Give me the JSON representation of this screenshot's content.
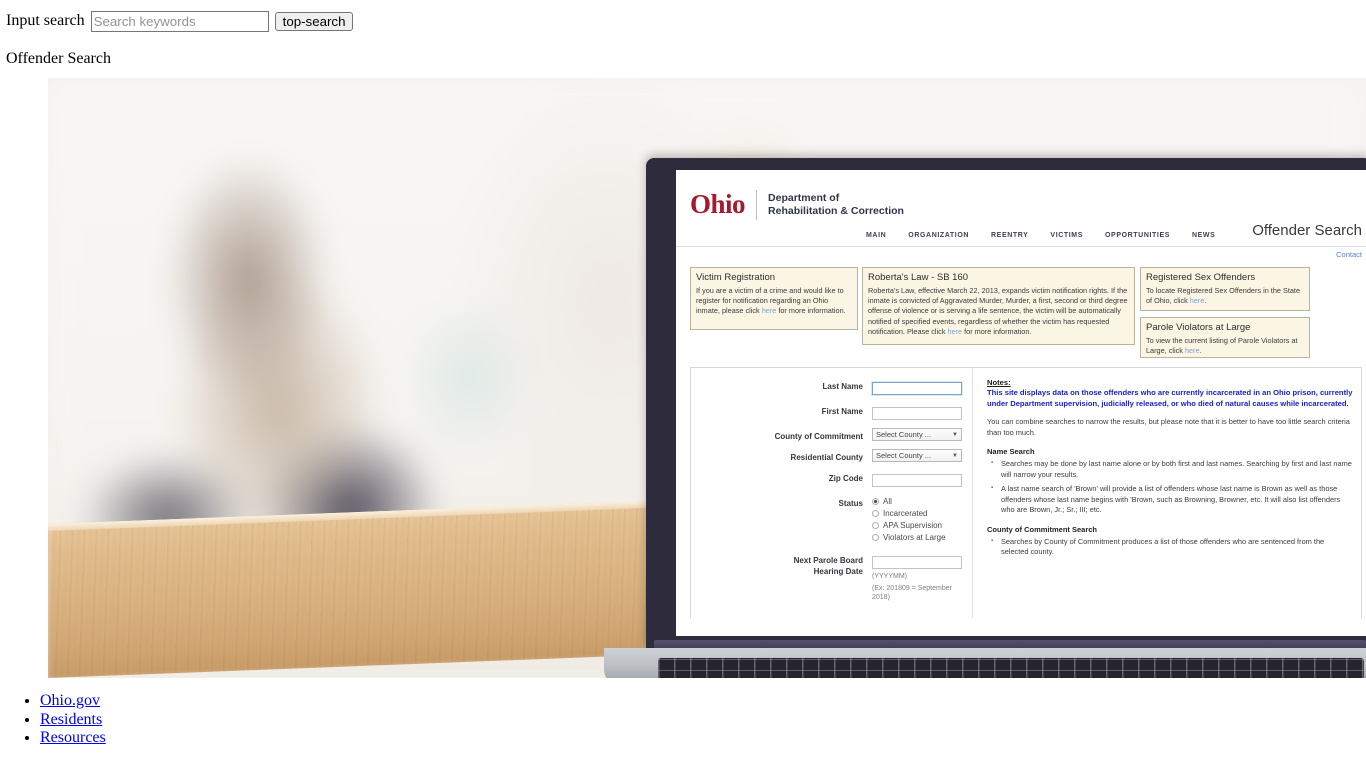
{
  "top_bar": {
    "label": "Input search",
    "placeholder": "Search keywords",
    "value": "",
    "button_label": "top-search"
  },
  "page_heading": "Offender Search",
  "site": {
    "brand": {
      "logo_word": "Ohio",
      "dept_line1": "Department of",
      "dept_line2": "Rehabilitation & Correction"
    },
    "title": "Offender Search",
    "nav": [
      {
        "label": "MAIN"
      },
      {
        "label": "ORGANIZATION"
      },
      {
        "label": "REENTRY"
      },
      {
        "label": "VICTIMS"
      },
      {
        "label": "OPPORTUNITIES"
      },
      {
        "label": "NEWS"
      }
    ],
    "contact_label": "Contact",
    "info_boxes": [
      {
        "title": "Victim Registration",
        "body_pre": "If you are a victim of a crime and would like to register for notification regarding an Ohio inmate, please click ",
        "link": "here",
        "body_post": " for more information."
      },
      {
        "title": "Roberta's Law - SB 160",
        "body_pre": "Roberta's Law, effective March 22, 2013, expands victim notification rights. If the inmate is convicted of Aggravated Murder, Murder, a first, second or third degree offense of violence or is serving a life sentence, the victim will be automatically notified of specified events, regardless of whether the victim has requested notification. Please click ",
        "link": "here",
        "body_post": " for more information."
      },
      {
        "title": "Registered Sex Offenders",
        "body_pre": "To locate Registered Sex Offenders in the State of Ohio, click ",
        "link": "here",
        "body_post": "."
      },
      {
        "title": "Parole Violators at Large",
        "body_pre": "To view the current listing of Parole Violators at Large, click ",
        "link": "here",
        "body_post": "."
      }
    ],
    "form": {
      "last_name": {
        "label": "Last Name",
        "value": ""
      },
      "first_name": {
        "label": "First Name",
        "value": ""
      },
      "county_commitment": {
        "label": "County of Commitment",
        "value": "Select County ..."
      },
      "residential_county": {
        "label": "Residential County",
        "value": "Select County ..."
      },
      "zip_code": {
        "label": "Zip Code",
        "value": ""
      },
      "status": {
        "label": "Status",
        "options": [
          {
            "label": "All",
            "selected": true
          },
          {
            "label": "Incarcerated",
            "selected": false
          },
          {
            "label": "APA Supervision",
            "selected": false
          },
          {
            "label": "Violators at Large",
            "selected": false
          }
        ]
      },
      "hearing_date": {
        "label_line1": "Next Parole Board",
        "label_line2": "Hearing Date",
        "value": "",
        "hint_format": "(YYYYMM)",
        "hint_example": "(Ex: 201809 = September 2018)"
      }
    },
    "notes": {
      "heading": "Notes:",
      "highlight": "This site displays data on those offenders who are currently incarcerated in an Ohio prison, currently under Department supervision, judicially released, or who died of natural causes while incarcerated.",
      "paragraph": "You can combine searches to narrow the results, but please note that it is better to have too little search criteria than too much.",
      "name_search_heading": "Name Search",
      "name_search_items": [
        "Searches may be done by last name alone or by both first and last names. Searching by first and last name will narrow your results.",
        "A last name search of 'Brown' will provide a list of offenders whose last name is Brown as well as those offenders whose last name begins with 'Brown, such as Browning, Browner, etc. It will also list offenders who are Brown, Jr.; Sr.; III; etc."
      ],
      "county_search_heading": "County of Commitment Search",
      "county_search_items": [
        "Searches by County of Commitment produces a list of those offenders who are sentenced from the selected county."
      ]
    }
  },
  "footer_links": [
    {
      "label": "Ohio.gov"
    },
    {
      "label": "Residents"
    },
    {
      "label": "Resources"
    }
  ],
  "colors": {
    "brand_red": "#a6192e",
    "nav_navy": "#3b4256",
    "link_blue": "#0000ee",
    "notes_blue": "#1a22c4",
    "info_box_bg": "#fbf5e4"
  }
}
